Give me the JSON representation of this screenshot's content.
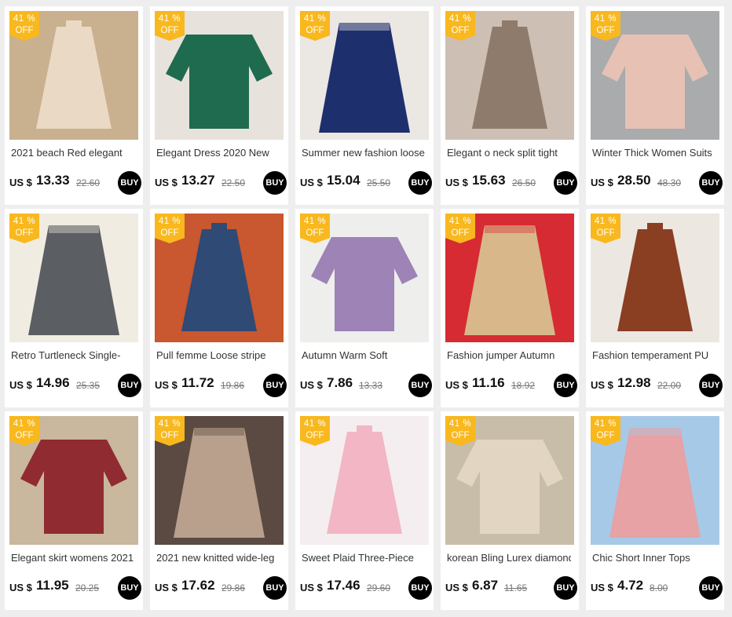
{
  "currency_label": "US $",
  "discount_badge": {
    "line1": "41 %",
    "line2": "OFF",
    "color": "#f8b81e"
  },
  "buy_label": "BUY",
  "products": [
    {
      "title": "2021 beach Red elegant",
      "price": "13.33",
      "old_price": "22.60",
      "colors": [
        "#ead9c4",
        "#c9b08e"
      ]
    },
    {
      "title": "Elegant Dress 2020 New",
      "price": "13.27",
      "old_price": "22.50",
      "colors": [
        "#1f6b4f",
        "#e8e2dc"
      ]
    },
    {
      "title": "Summer new fashion loose",
      "price": "15.04",
      "old_price": "25.50",
      "colors": [
        "#1e2f6e",
        "#ebe7e2"
      ]
    },
    {
      "title": "Elegant o neck split tight",
      "price": "15.63",
      "old_price": "26.50",
      "colors": [
        "#8e7b6b",
        "#cdbfb3"
      ]
    },
    {
      "title": "Winter Thick Women Suits",
      "price": "28.50",
      "old_price": "48.30",
      "colors": [
        "#e7c1b4",
        "#a9abad"
      ]
    },
    {
      "title": "Retro Turtleneck Single-",
      "price": "14.96",
      "old_price": "25.35",
      "colors": [
        "#5b5e63",
        "#f1ece2"
      ]
    },
    {
      "title": "Pull femme Loose stripe",
      "price": "11.72",
      "old_price": "19.86",
      "colors": [
        "#2f4a74",
        "#c9572f"
      ]
    },
    {
      "title": "Autumn Warm Soft",
      "price": "7.86",
      "old_price": "13.33",
      "colors": [
        "#9d83b6",
        "#eeeeec"
      ]
    },
    {
      "title": "Fashion jumper Autumn",
      "price": "11.16",
      "old_price": "18.92",
      "colors": [
        "#d8b88a",
        "#d62b33"
      ]
    },
    {
      "title": "Fashion temperament PU",
      "price": "12.98",
      "old_price": "22.00",
      "colors": [
        "#8a3e22",
        "#ece7e1"
      ]
    },
    {
      "title": "Elegant skirt womens 2021",
      "price": "11.95",
      "old_price": "20.25",
      "colors": [
        "#8f2b31",
        "#c9b79e"
      ]
    },
    {
      "title": "2021 new knitted wide-leg",
      "price": "17.62",
      "old_price": "29.86",
      "colors": [
        "#b9a08c",
        "#5b4a42"
      ]
    },
    {
      "title": "Sweet Plaid Three-Piece",
      "price": "17.46",
      "old_price": "29.60",
      "colors": [
        "#f2b6c4",
        "#f5eef0"
      ]
    },
    {
      "title": "korean Bling Lurex diamond",
      "price": "6.87",
      "old_price": "11.65",
      "colors": [
        "#e2d6c2",
        "#c8bda9"
      ]
    },
    {
      "title": "Chic Short Inner Tops",
      "price": "4.72",
      "old_price": "8.00",
      "colors": [
        "#e6a2a4",
        "#a6c9e8"
      ]
    }
  ]
}
